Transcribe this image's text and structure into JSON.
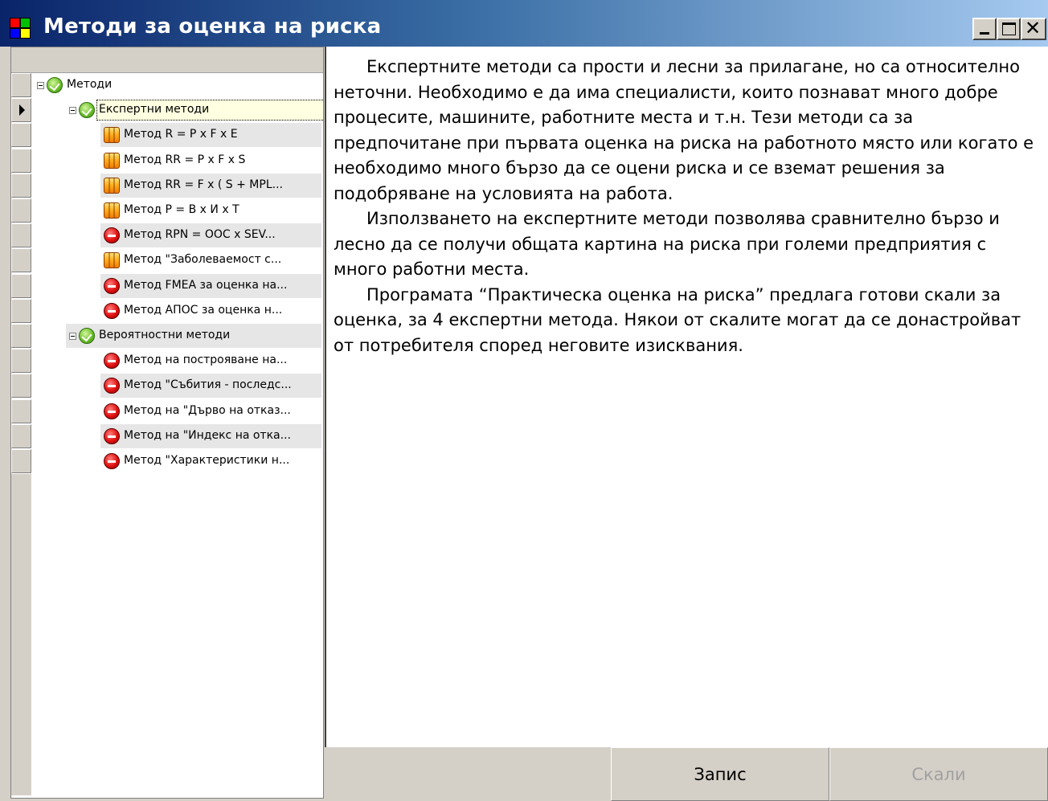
{
  "window": {
    "title": "Методи за оценка на риска",
    "controls": [
      "minimize",
      "maximize",
      "close"
    ]
  },
  "tree": {
    "rows": [
      {
        "label": "Методи",
        "icon": "check-icon",
        "level": 0,
        "expander": true
      },
      {
        "label": "Експертни методи",
        "icon": "check-icon",
        "level": 1,
        "expander": true,
        "selected": true
      },
      {
        "label": "Метод  R = P x F x E",
        "icon": "orange-method-icon",
        "level": 2
      },
      {
        "label": "Метод  RR = P x F x S",
        "icon": "orange-method-icon",
        "level": 2
      },
      {
        "label": "Метод  RR = F x ( S + MPL...",
        "icon": "orange-method-icon",
        "level": 2
      },
      {
        "label": "Метод  P = В x И x Т",
        "icon": "orange-method-icon",
        "level": 2
      },
      {
        "label": "Метод  RPN = ООС x SEV...",
        "icon": "stop-icon",
        "level": 2
      },
      {
        "label": "Метод \"Заболеваемост с...",
        "icon": "orange-method-icon",
        "level": 2
      },
      {
        "label": "Метод FMEA за оценка на...",
        "icon": "stop-icon",
        "level": 2
      },
      {
        "label": "Метод АПОС за оценка н...",
        "icon": "stop-icon",
        "level": 2
      },
      {
        "label": "Вероятностни методи",
        "icon": "check-icon",
        "level": 1,
        "expander": true
      },
      {
        "label": "Метод на построяване на...",
        "icon": "stop-icon",
        "level": 2
      },
      {
        "label": "Метод \"Събития - последс...",
        "icon": "stop-icon",
        "level": 2
      },
      {
        "label": "Метод на \"Дърво на отказ...",
        "icon": "stop-icon",
        "level": 2
      },
      {
        "label": "Метод на \"Индекс на отка...",
        "icon": "stop-icon",
        "level": 2
      },
      {
        "label": "Метод \"Характеристики н...",
        "icon": "stop-icon",
        "level": 2
      }
    ]
  },
  "description": {
    "paragraphs": [
      "Експертните методи са прости и лесни за прилагане, но са относително неточни. Необходимо е да има специалисти, които познават много добре процесите, машините, работните места и т.н. Тези методи са за предпочитане при първата оценка на риска на работното място или когато е необходимо много бързо да се оцени риска и се вземат решения за подобряване на условията на работа.",
      "Използването на експертните методи позволява сравнително бързо и лесно да се получи общата картина на риска при големи предприятия с много работни места.",
      "Програмата “Практическа оценка на риска” предлага готови скали за оценка, за 4 експертни метода. Някои от скалите могат да се донастройват от потребителя според неговите изисквания."
    ]
  },
  "buttons": {
    "save_label": "Запис",
    "scales_label": "Скали",
    "scales_enabled": false
  },
  "colors": {
    "titlebar_start": "#0a246a",
    "titlebar_end": "#a6caf0",
    "disabled_text": "#a0a0a0"
  }
}
